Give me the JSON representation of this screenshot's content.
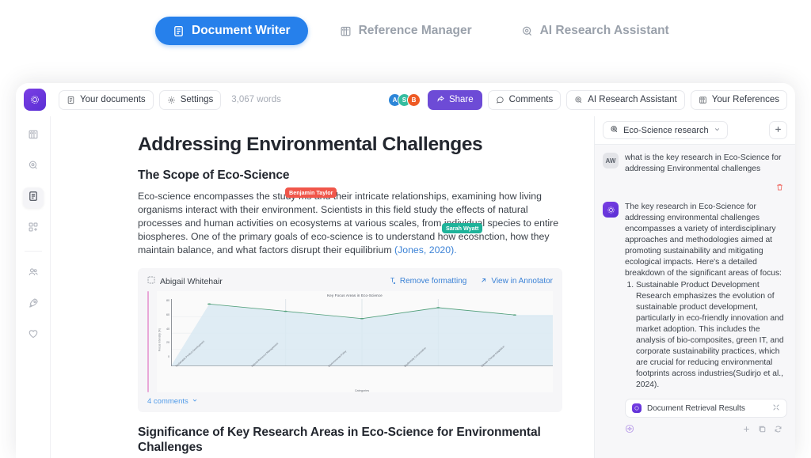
{
  "top_tabs": [
    {
      "label": "Document Writer",
      "icon": "document-icon",
      "active": true
    },
    {
      "label": "Reference Manager",
      "icon": "library-icon",
      "active": false
    },
    {
      "label": "AI Research Assistant",
      "icon": "ai-chat-icon",
      "active": false
    }
  ],
  "toolbar": {
    "logo_icon": "app-logo-icon",
    "your_documents": "Your documents",
    "settings": "Settings",
    "word_count": "3,067 words",
    "avatars": [
      {
        "initial": "A",
        "color": "#2d86d8"
      },
      {
        "initial": "S",
        "color": "#35bda0"
      },
      {
        "initial": "B",
        "color": "#ee5a24"
      }
    ],
    "share": "Share",
    "share_color": "#6d4bd6",
    "comments": "Comments",
    "ai_research_assistant": "AI Research Assistant",
    "your_references": "Your References"
  },
  "rail": [
    {
      "name": "sidebar-item-library",
      "icon": "library-icon"
    },
    {
      "name": "sidebar-item-assistant",
      "icon": "ai-chat-icon"
    },
    {
      "name": "sidebar-item-documents",
      "icon": "document-icon",
      "active": true
    },
    {
      "name": "sidebar-item-widgets",
      "icon": "add-widget-icon"
    },
    {
      "name": "sidebar-item-team",
      "icon": "users-icon"
    },
    {
      "name": "sidebar-item-launch",
      "icon": "rocket-icon"
    },
    {
      "name": "sidebar-item-favorites",
      "icon": "heart-icon"
    }
  ],
  "document": {
    "title": "Addressing Environmental Challenges",
    "section1_heading": "The Scope of Eco-Science",
    "paragraph1_a": "Eco-science encompasses the study ",
    "paragraph1_b": "ms and their intricate relationships, examining how living organisms interact with their environment. Scientists in this field study the effects of natural processes and human activities on ecosystems at various scales, from individual species to entire biospheres. One of the primary goals of eco-science is to understand how ecos",
    "paragraph1_c": "nction, how they maintain balance, and what factors disrupt their equilibrium ",
    "citation": "(Jones, 2020).",
    "tag_red": "Benjamin Taylor",
    "tag_red_color": "#f0564a",
    "tag_teal": "Sarah Wyatt",
    "tag_teal_color": "#1fb39a",
    "figure": {
      "author": "Abigail Whitehair",
      "remove_formatting": "Remove formatting",
      "view_in_annotator": "View in Annotator",
      "comments": "4 comments"
    },
    "section2_heading": "Significance of Key Research Areas in Eco-Science for Environmental Challenges"
  },
  "chart_data": {
    "type": "area",
    "title": "Key Focus Areas in Eco-Science",
    "xlabel": "Categories",
    "ylabel": "Focus Intensity (%)",
    "categories": [
      "Sustainable Product Development",
      "Natural Resource Management",
      "Environmental Policy",
      "Biodiversity Conservation",
      "Climate Change Adaptation"
    ],
    "values": [
      85,
      75,
      65,
      80,
      70
    ],
    "ylim": [
      0,
      90
    ],
    "yticks": [
      80,
      60,
      40,
      20,
      0
    ],
    "line_color": "#4f9e78",
    "fill_color": "#d9e9f2",
    "grid": true
  },
  "chat": {
    "thread_label": "Eco-Science research",
    "add_label": "+",
    "user": {
      "initials": "AW",
      "message": "what is the key research in Eco-Science for addressing Environmental challenges"
    },
    "assistant": {
      "intro": "The key research in Eco-Science for addressing environmental challenges encompasses a variety of interdisciplinary approaches and methodologies aimed at promoting sustainability and mitigating ecological impacts. Here's a detailed breakdown of the significant areas of focus:",
      "list_items": [
        "Sustainable Product Development Research emphasizes the evolution of sustainable product development, particularly in eco-friendly innovation and market adoption. This includes the analysis of bio-composites, green IT, and corporate sustainability practices, which are crucial for reducing environmental footprints across industries(Sudirjo et al., 2024)."
      ],
      "retrieval_label": "Document Retrieval Results"
    }
  }
}
